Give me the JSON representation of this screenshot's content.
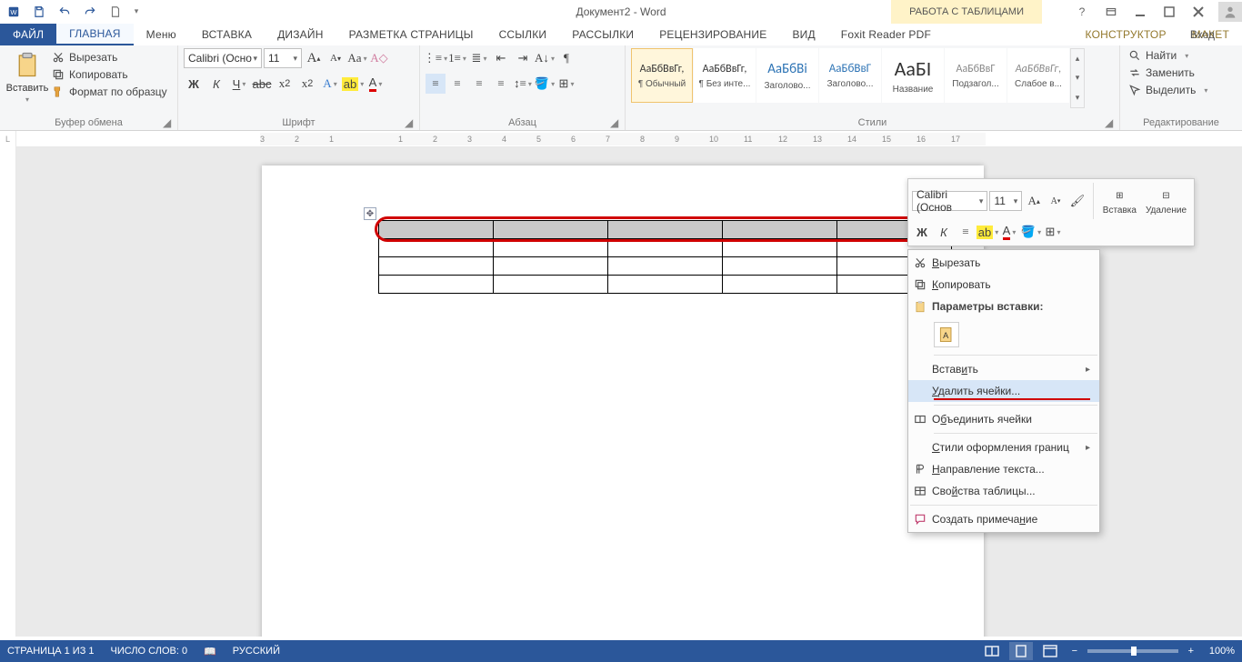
{
  "title": "Документ2 - Word",
  "table_tools_label": "РАБОТА С ТАБЛИЦАМИ",
  "login_label": "Вход",
  "tabs": {
    "file": "ФАЙЛ",
    "home": "ГЛАВНАЯ",
    "menu": "Меню",
    "insert": "ВСТАВКА",
    "design": "ДИЗАЙН",
    "layout": "РАЗМЕТКА СТРАНИЦЫ",
    "references": "ССЫЛКИ",
    "mailings": "РАССЫЛКИ",
    "review": "РЕЦЕНЗИРОВАНИЕ",
    "view": "ВИД",
    "foxit": "Foxit Reader PDF",
    "design_table": "КОНСТРУКТОР",
    "layout_table": "МАКЕТ"
  },
  "ribbon": {
    "clipboard": {
      "group": "Буфер обмена",
      "paste": "Вставить",
      "cut": "Вырезать",
      "copy": "Копировать",
      "format_painter": "Формат по образцу"
    },
    "font": {
      "group": "Шрифт",
      "name": "Calibri (Осно",
      "size": "11"
    },
    "paragraph": {
      "group": "Абзац"
    },
    "styles": {
      "group": "Стили",
      "items": [
        {
          "preview": "АаБбВвГг,",
          "name": "¶ Обычный"
        },
        {
          "preview": "АаБбВвГг,",
          "name": "¶ Без инте..."
        },
        {
          "preview": "АаБбВі",
          "name": "Заголово..."
        },
        {
          "preview": "АаБбВвГ",
          "name": "Заголово..."
        },
        {
          "preview": "АаБІ",
          "name": "Название"
        },
        {
          "preview": "АаБбВвГ",
          "name": "Подзагол..."
        },
        {
          "preview": "АаБбВвГг,",
          "name": "Слабое в..."
        }
      ]
    },
    "editing": {
      "group": "Редактирование",
      "find": "Найти",
      "replace": "Заменить",
      "select": "Выделить"
    }
  },
  "mini": {
    "font_name": "Calibri (Основ",
    "font_size": "11",
    "insert": "Вставка",
    "delete": "Удаление"
  },
  "ctx": {
    "cut": "Вырезать",
    "copy": "Копировать",
    "paste_heading": "Параметры вставки:",
    "insert": "Вставить",
    "delete_cells": "Удалить ячейки...",
    "merge_cells": "Объединить ячейки",
    "border_styles": "Стили оформления границ",
    "text_direction": "Направление текста...",
    "table_props": "Свойства таблицы...",
    "new_comment": "Создать примечание"
  },
  "status": {
    "page": "СТРАНИЦА 1 ИЗ 1",
    "words": "ЧИСЛО СЛОВ: 0",
    "lang": "РУССКИЙ",
    "zoom": "100%"
  },
  "ruler_marks": [
    "3",
    "2",
    "1",
    "",
    "1",
    "2",
    "3",
    "4",
    "5",
    "6",
    "7",
    "8",
    "9",
    "10",
    "11",
    "12",
    "13",
    "14",
    "15",
    "16",
    "17"
  ]
}
